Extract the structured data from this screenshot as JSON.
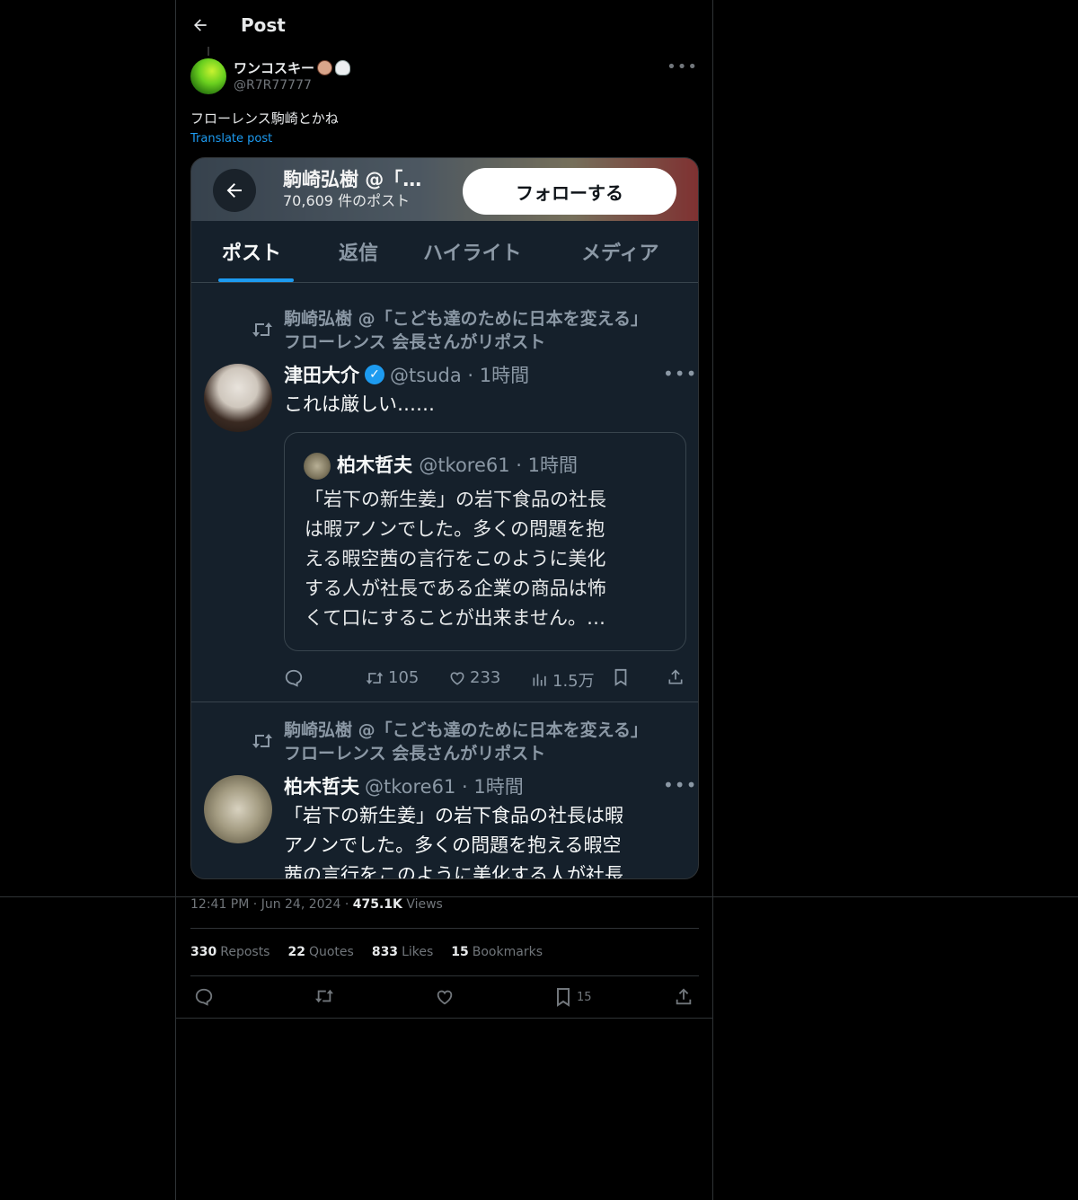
{
  "header": {
    "title": "Post"
  },
  "author": {
    "name": "ワンコスキー",
    "handle": "@R7R77777"
  },
  "post": {
    "text": "フローレンス駒崎とかね",
    "translate": "Translate post"
  },
  "media": {
    "profile_title": "駒崎弘樹 @「…",
    "post_count": "70,609 件のポスト",
    "follow_label": "フォローする",
    "tabs": [
      "ポスト",
      "返信",
      "ハイライト",
      "メディア"
    ],
    "repost_line1": "駒崎弘樹 @「こども達のために日本を変える」",
    "repost_line2": "フローレンス 会長さんがリポスト",
    "tweet1": {
      "name": "津田大介",
      "handle": "@tsuda · 1時間",
      "text": "これは厳しい……",
      "quote": {
        "name": "柏木哲夫",
        "handle": "@tkore61 · 1時間",
        "lines": [
          "「岩下の新生姜」の岩下食品の社長",
          "は暇アノンでした。多くの問題を抱",
          "える暇空茜の言行をこのように美化",
          "する人が社長である企業の商品は怖",
          "くて口にすることが出来ません。…"
        ]
      },
      "actions": {
        "retweets": "105",
        "likes": "233",
        "views": "1.5万"
      }
    },
    "tweet2": {
      "name": "柏木哲夫",
      "handle": "@tkore61 · 1時間",
      "lines": [
        "「岩下の新生姜」の岩下食品の社長は暇",
        "アノンでした。多くの問題を抱える暇空",
        "茜の言行をこのように美化する人が社長"
      ]
    }
  },
  "meta": {
    "time": "12:41 PM",
    "date": "Jun 24, 2024",
    "views_count": "475.1K",
    "views_label": "Views"
  },
  "stats": [
    {
      "count": "330",
      "label": "Reposts"
    },
    {
      "count": "22",
      "label": "Quotes"
    },
    {
      "count": "833",
      "label": "Likes"
    },
    {
      "count": "15",
      "label": "Bookmarks"
    }
  ],
  "actions": {
    "bookmark_count": "15"
  },
  "colors": {
    "accent": "#1d9bf0",
    "background": "#000000",
    "muted": "#71767b"
  }
}
